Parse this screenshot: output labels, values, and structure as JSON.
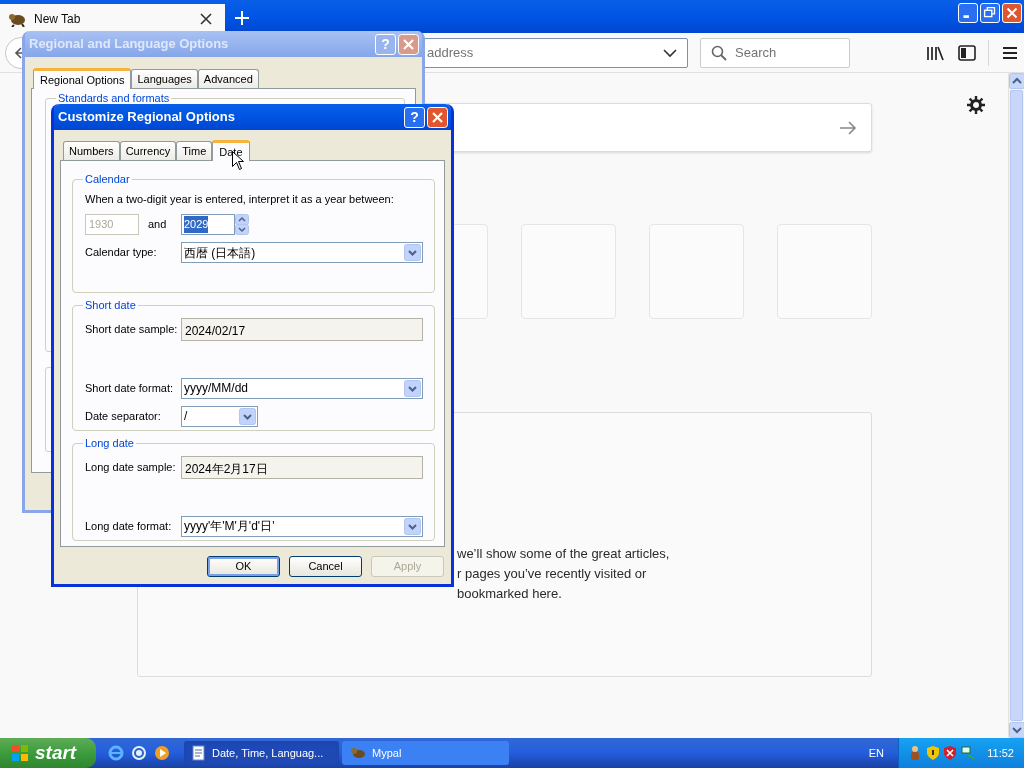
{
  "browser": {
    "tabs": [
      {
        "label": "New Tab",
        "selected": true
      }
    ],
    "address_field": {
      "placeholder": "address"
    },
    "search_field": {
      "placeholder": "Search"
    },
    "highlights_message": [
      "we’ll show some of the great articles,",
      "r pages you’ve recently visited or",
      "bookmarked here."
    ]
  },
  "background_dialog": {
    "title": "Regional and Language Options",
    "active": false,
    "help_button": "?",
    "tabs": [
      {
        "label": "Regional Options",
        "selected": true
      },
      {
        "label": "Languages",
        "selected": false
      },
      {
        "label": "Advanced",
        "selected": false
      }
    ],
    "group_title": "Standards and formats"
  },
  "dialog": {
    "title": "Customize Regional Options",
    "active": true,
    "help_button": "?",
    "tabs": [
      {
        "label": "Numbers",
        "selected": false
      },
      {
        "label": "Currency",
        "selected": false
      },
      {
        "label": "Time",
        "selected": false
      },
      {
        "label": "Date",
        "selected": true
      }
    ],
    "groups": [
      {
        "title": "Calendar",
        "rows": [
          {
            "kind": "text",
            "text": "When a two-digit year is entered, interpret it as a year between:"
          },
          {
            "kind": "year_range",
            "from": {
              "value": "1930",
              "disabled": true
            },
            "joiner": "and",
            "to": {
              "value": "2029",
              "highlighted": true
            }
          },
          {
            "kind": "dropdown",
            "label": "Calendar type:",
            "value": "西暦 (日本語)"
          }
        ]
      },
      {
        "title": "Short date",
        "rows": [
          {
            "kind": "sample",
            "label": "Short date sample:",
            "value": "2024/02/17"
          },
          {
            "kind": "dropdown",
            "label": "Short date format:",
            "value": "yyyy/MM/dd"
          },
          {
            "kind": "small_dropdown",
            "label": "Date separator:",
            "value": "/"
          }
        ]
      },
      {
        "title": "Long date",
        "rows": [
          {
            "kind": "sample",
            "label": "Long date sample:",
            "value": "2024年2月17日"
          },
          {
            "kind": "dropdown",
            "label": "Long date format:",
            "value": "yyyy'年'M'月'd'日'"
          }
        ]
      }
    ],
    "buttons": [
      {
        "label": "OK",
        "default": true,
        "disabled": false
      },
      {
        "label": "Cancel",
        "default": false,
        "disabled": false
      },
      {
        "label": "Apply",
        "default": false,
        "disabled": true
      }
    ]
  },
  "taskbar": {
    "start": "start",
    "tasks": [
      {
        "label": "Date, Time, Languag...",
        "selected": true
      },
      {
        "label": "Mypal",
        "selected": false
      }
    ],
    "language": "EN",
    "clock": "11:52"
  }
}
